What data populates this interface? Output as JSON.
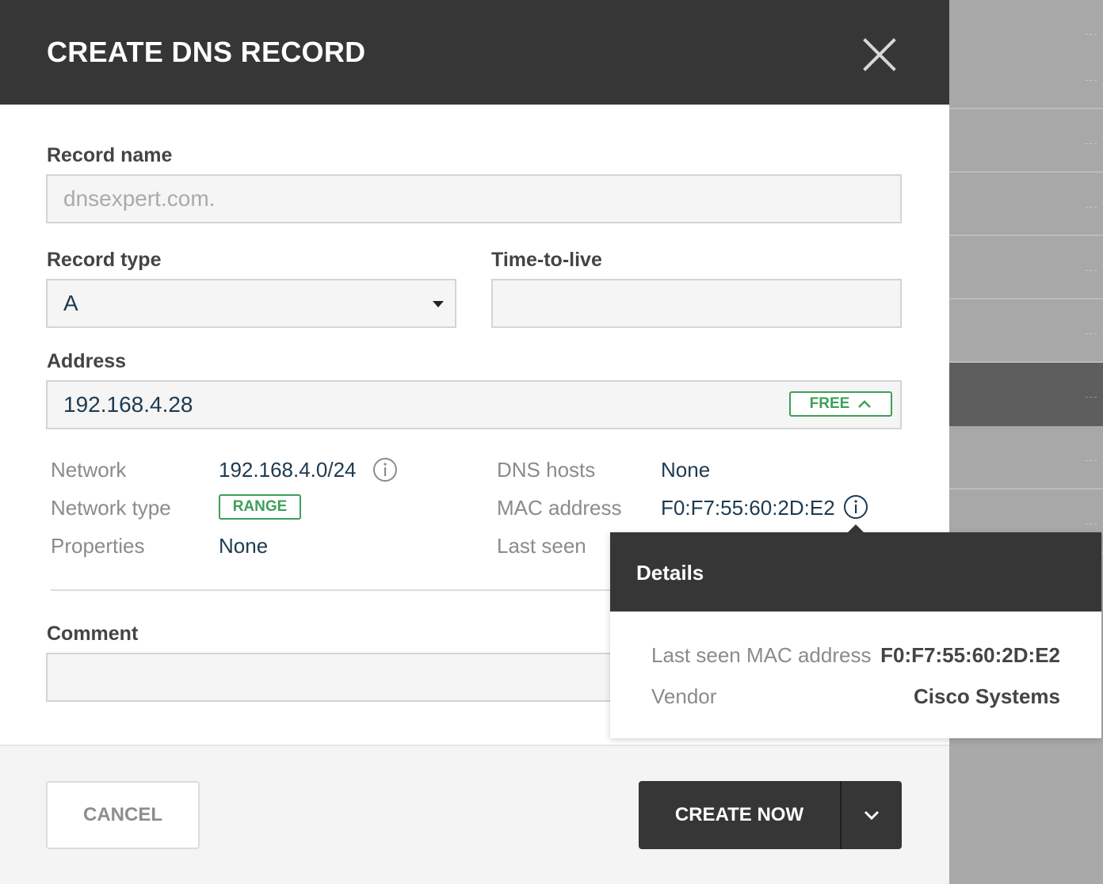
{
  "dialog": {
    "title": "CREATE DNS RECORD"
  },
  "form": {
    "record_name": {
      "label": "Record name",
      "placeholder": "dnsexpert.com.",
      "value": ""
    },
    "record_type": {
      "label": "Record type",
      "value": "A"
    },
    "ttl": {
      "label": "Time-to-live",
      "value": ""
    },
    "address": {
      "label": "Address",
      "value": "192.168.4.28",
      "status_badge": "FREE"
    },
    "comment": {
      "label": "Comment",
      "value": ""
    }
  },
  "details": {
    "network_label": "Network",
    "network_value": "192.168.4.0/24",
    "network_type_label": "Network type",
    "network_type_value": "RANGE",
    "properties_label": "Properties",
    "properties_value": "None",
    "dns_hosts_label": "DNS hosts",
    "dns_hosts_value": "None",
    "mac_label": "MAC address",
    "mac_value": "F0:F7:55:60:2D:E2",
    "last_seen_label": "Last seen"
  },
  "popover": {
    "title": "Details",
    "last_seen_mac_label": "Last seen MAC address",
    "last_seen_mac_value": "F0:F7:55:60:2D:E2",
    "vendor_label": "Vendor",
    "vendor_value": "Cisco Systems"
  },
  "footer": {
    "cancel_label": "CANCEL",
    "create_label": "CREATE NOW"
  },
  "colors": {
    "header_bg": "#363636",
    "accent_green": "#3f9f59",
    "value_text": "#1e3a4f"
  }
}
